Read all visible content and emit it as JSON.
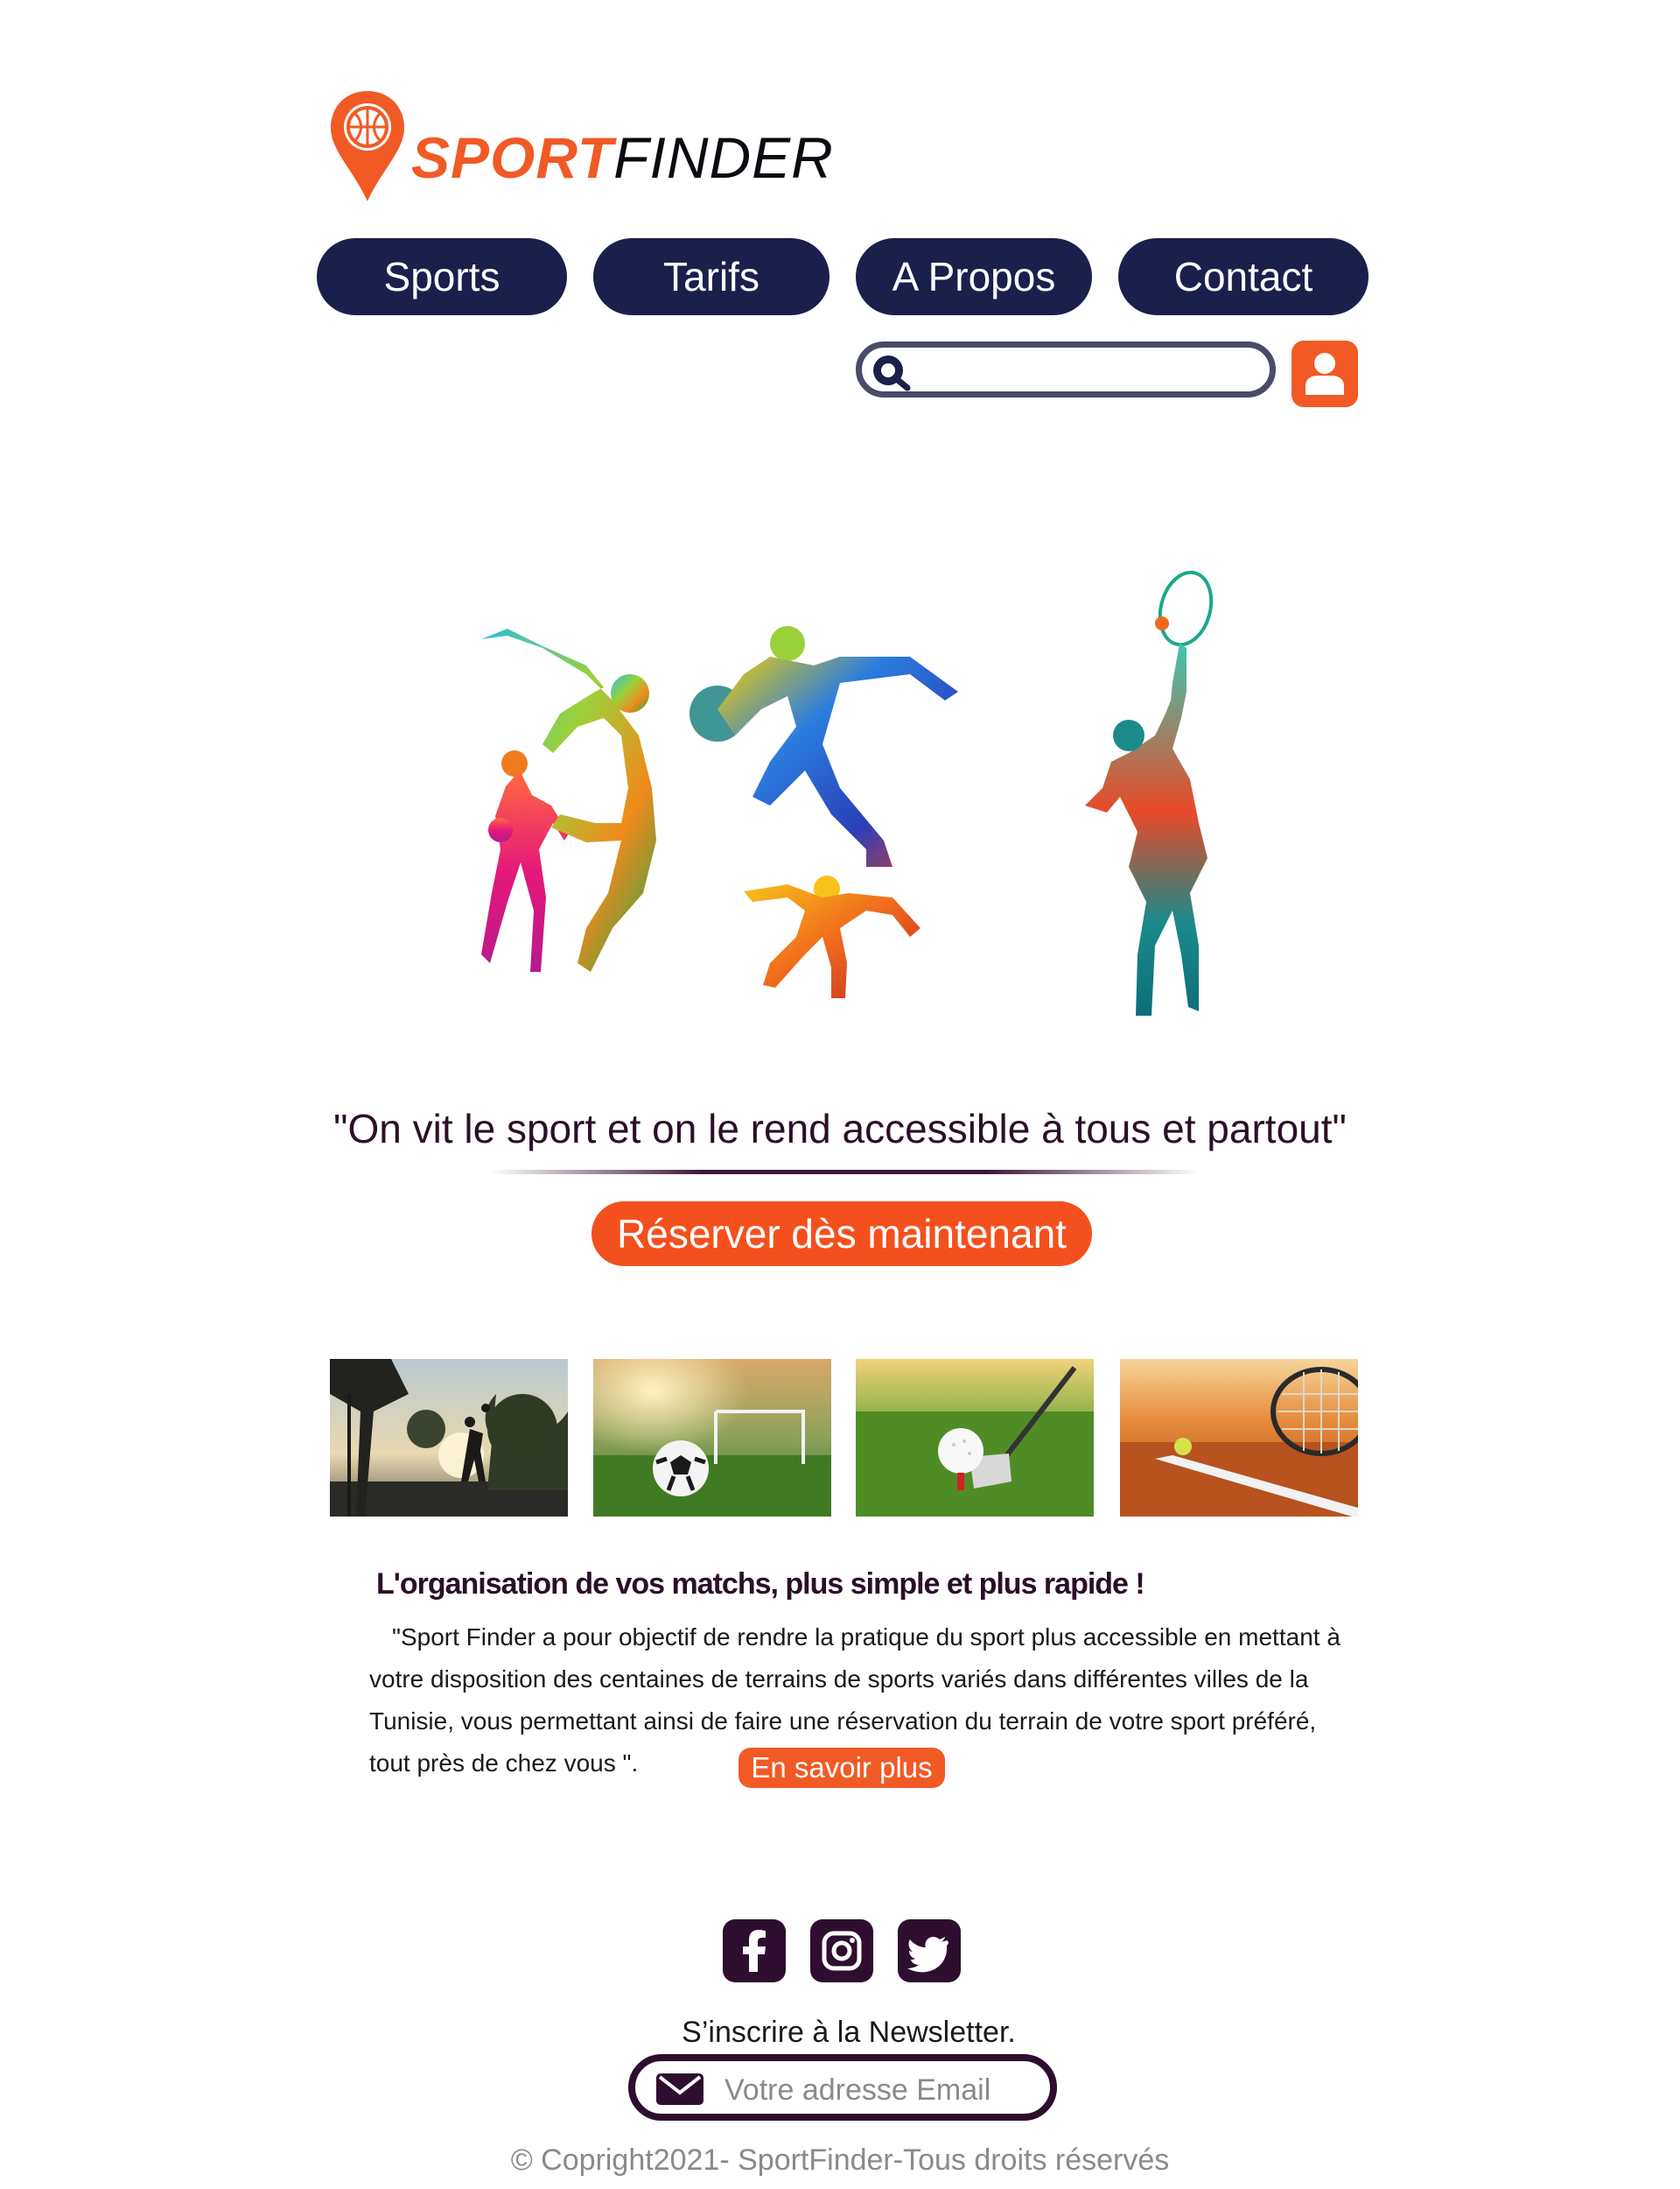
{
  "brand": {
    "name_part1": "SPORT",
    "name_part2": "FINDER",
    "accent": "#F15A24",
    "nav_color": "#1B1F4B"
  },
  "nav": {
    "items": [
      {
        "label": "Sports"
      },
      {
        "label": "Tarifs"
      },
      {
        "label": "A Propos"
      },
      {
        "label": "Contact"
      }
    ]
  },
  "search": {
    "placeholder": "",
    "icon": "search-icon"
  },
  "account": {
    "icon": "user-icon"
  },
  "hero": {
    "tagline": "\"On vit le sport et on le rend accessible à tous et partout\"",
    "cta_label": "Réserver dès maintenant"
  },
  "gallery": [
    {
      "icon": "basketball-photo"
    },
    {
      "icon": "football-photo"
    },
    {
      "icon": "golf-photo"
    },
    {
      "icon": "tennis-photo"
    }
  ],
  "about": {
    "title": "L'organisation de vos matchs, plus simple et plus rapide !",
    "body": "\"Sport Finder a pour objectif de rendre la pratique du sport plus accessible en mettant à votre disposition des centaines de terrains de sports variés dans différentes villes de la Tunisie, vous permettant ainsi de faire une réservation du terrain de votre sport préféré, tout près de chez vous \".",
    "more_label": "En savoir plus"
  },
  "footer": {
    "social": [
      "facebook-icon",
      "instagram-icon",
      "twitter-icon"
    ],
    "newsletter_label": "S’inscrire  à la Newsletter.",
    "email_placeholder": "Votre adresse Email",
    "copyright": "© Copright2021- SportFinder-Tous droits réservés"
  }
}
